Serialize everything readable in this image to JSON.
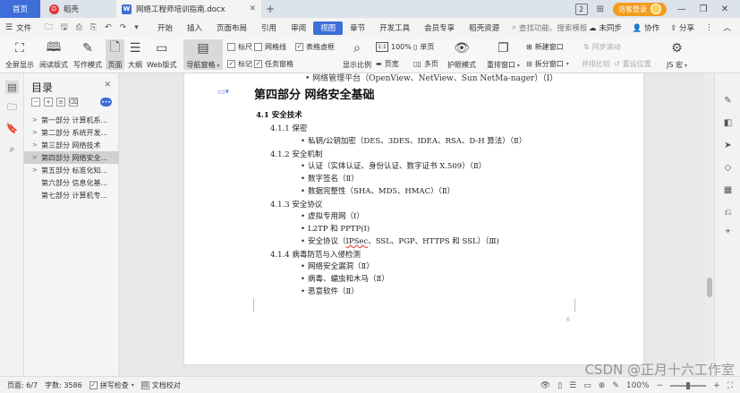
{
  "titlebar": {
    "home_tab": "首页",
    "docer_tab": "稻壳",
    "doc_tab": "网络工程师培训指南.docx",
    "docer_logo": "D",
    "doc_logo": "W",
    "page_badge": "2",
    "login_label": "访客登录"
  },
  "menubar": {
    "file": "文件",
    "items": [
      "开始",
      "插入",
      "页面布局",
      "引用",
      "审阅",
      "视图",
      "章节",
      "开发工具",
      "会员专享",
      "稻壳资源"
    ],
    "search": "查找功能、搜索模板",
    "sync": "未同步",
    "collab": "协作",
    "share": "分享"
  },
  "ribbon": {
    "fullscreen": "全屏显示",
    "reading": "阅读版式",
    "writing": "写作模式",
    "page": "页面",
    "outline": "大纲",
    "web": "Web版式",
    "nav_pane": "导航窗格",
    "ruler": "标尺",
    "gridlines": "网格线",
    "table_border": "表格虚框",
    "marks": "标记",
    "task_pane": "任务窗格",
    "zoom": "显示比例",
    "zoom_value": "100%",
    "single_page": "单页",
    "page_width": "页宽",
    "multi_page": "多页",
    "eye_mode": "护眼模式",
    "rearrange": "重排窗口",
    "new_window": "新建窗口",
    "split_window": "拆分窗口",
    "sync_scroll": "同步滚动",
    "side_compare": "并排比较",
    "reset_pos": "重设位置",
    "js_macro": "JS 宏"
  },
  "outline": {
    "title": "目录",
    "items": [
      {
        "label": "第一部分 计算机系...",
        "arrow": true,
        "selected": false
      },
      {
        "label": "第二部分 系统开发...",
        "arrow": true,
        "selected": false
      },
      {
        "label": "第三部分 网络技术",
        "arrow": true,
        "selected": false
      },
      {
        "label": "第四部分 网络安全...",
        "arrow": true,
        "selected": true
      },
      {
        "label": "第五部分 标准化知...",
        "arrow": true,
        "selected": false
      },
      {
        "label": "第六部分 信息化基...",
        "arrow": false,
        "selected": false
      },
      {
        "label": "第七部分 计算机专...",
        "arrow": false,
        "selected": false
      }
    ]
  },
  "document": {
    "prev_line": "网络管理平台（OpenView、NetView、Sun NetMa-nager）（Ⅰ）",
    "h1": "第四部分  网络安全基础",
    "h2": "4.1  安全技术",
    "sec1": "4.1.1 保密",
    "sec1_items": [
      "私钥/公钥加密（DES、3DES、IDEA、RSA、D-H 算法）（Ⅱ）"
    ],
    "sec2": "4.1.2 安全机制",
    "sec2_items": [
      "认证（实体认证、身份认证、数字证书 X.509）（Ⅱ）",
      "数字签名（Ⅱ）",
      "数据完整性（SHA、MD5、HMAC）（Ⅱ）"
    ],
    "sec3": "4.1.3 安全协议",
    "sec3_items": [
      "虚拟专用网（Ⅰ）",
      "L2TP 和  PPTP(Ⅰ)"
    ],
    "sec3_item3_prefix": "安全协议（",
    "sec3_item3_wavy": "IPSec",
    "sec3_item3_suffix": "、SSL、PGP、HTTPS 和  SSL）（Ⅲ)",
    "sec4": "4.1.4 病毒防范与入侵检测",
    "sec4_items": [
      "网络安全漏洞（Ⅱ）",
      "病毒、蠕虫和木马（Ⅱ）",
      "恶意软件（Ⅱ）"
    ],
    "page_number": "6"
  },
  "statusbar": {
    "page": "页面: 6/7",
    "words": "字数: 3586",
    "spell": "拼写检查",
    "proofread": "文档校对",
    "zoom": "100%"
  },
  "watermark": "CSDN @正月十六工作室"
}
